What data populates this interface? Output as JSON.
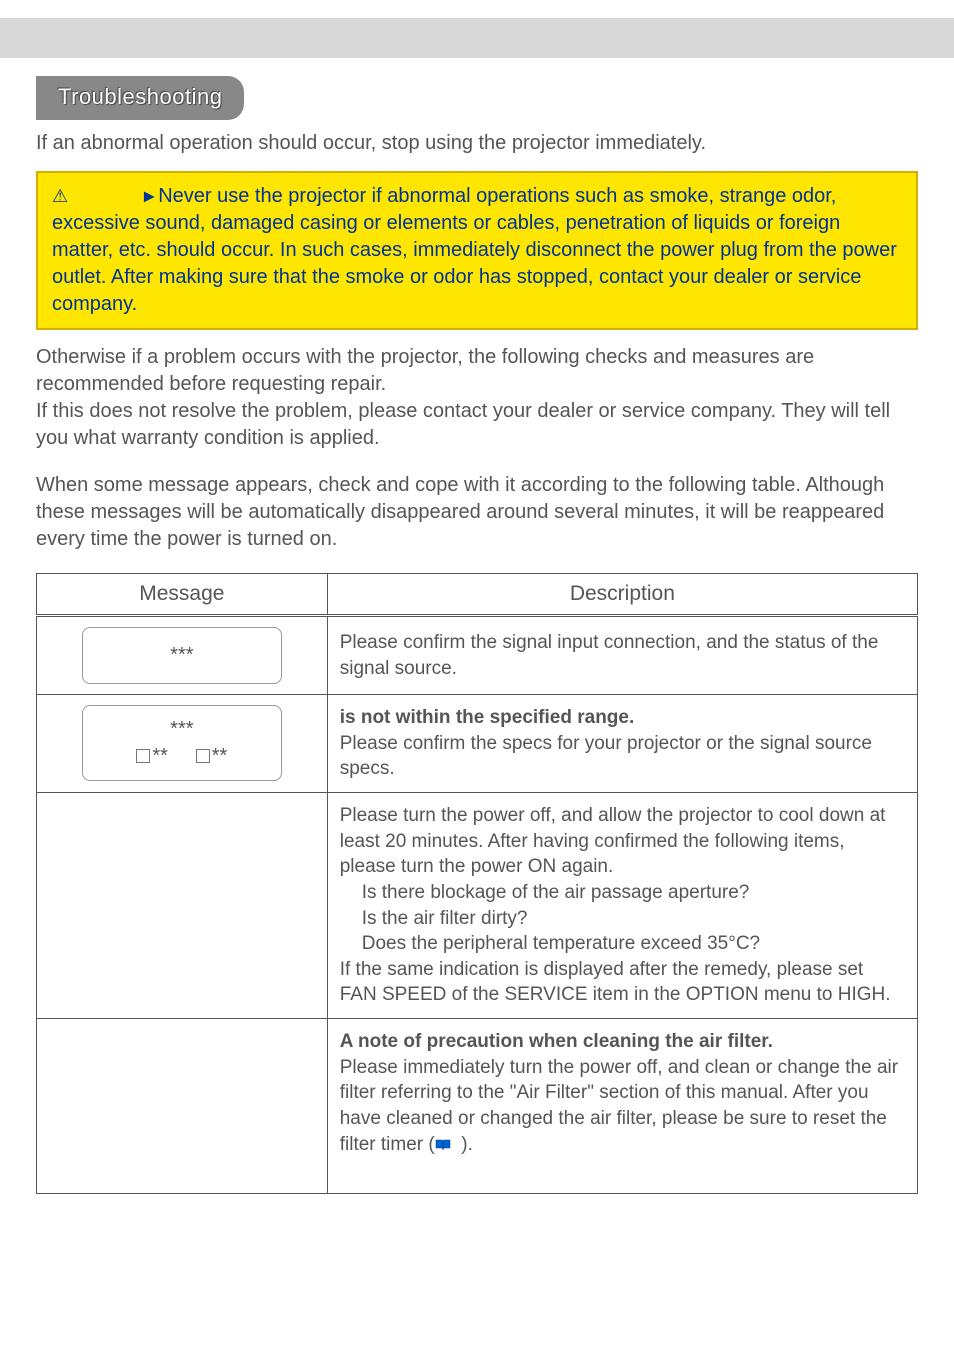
{
  "header": {
    "section_title": "Troubleshooting"
  },
  "intro": "If an abnormal operation should occur, stop using the projector immediately.",
  "warning": {
    "arrow": "►",
    "text": "Never use the projector if abnormal operations such as smoke, strange odor, excessive sound, damaged casing or elements or cables, penetration of liquids or foreign matter, etc. should occur. In such cases, immediately disconnect the power plug from the power outlet. After making sure that the smoke or odor has stopped, contact your dealer or service company."
  },
  "para1": "Otherwise if a problem occurs with the projector, the following checks and measures are recommended before requesting repair.",
  "para2": "If this does not resolve the problem, please contact your dealer or service company. They will tell you what warranty condition is applied.",
  "para3": "When some message appears, check and cope with it according to the following table. Although these messages will be automatically disappeared around several minutes, it will be reappeared every time the power is turned on.",
  "table": {
    "col_message": "Message",
    "col_description": "Description",
    "rows": [
      {
        "msg": "***",
        "desc": "Please confirm the signal input connection, and the status of the signal source."
      },
      {
        "msg_line1": "***",
        "msg_cb1": "**",
        "msg_cb2": "**",
        "desc_bold": "is not within the specified range.",
        "desc_rest": "Please confirm the specs for your projector or the signal source specs."
      },
      {
        "d1": "Please turn the power off, and allow the projector to cool down at least 20 minutes. After having confirmed the following items, please turn the power ON again.",
        "b1": "Is there blockage of the air passage aperture?",
        "b2": "Is the air filter dirty?",
        "b3": "Does the peripheral temperature exceed 35°C?",
        "d2": "If the same indication is displayed after the remedy, please set FAN SPEED of the SERVICE item in the OPTION menu to HIGH."
      },
      {
        "title": "A note of precaution when cleaning the air filter.",
        "body1": "Please immediately turn the power off, and clean or change the air filter referring to the \"Air Filter\" section of this manual. After you have cleaned or changed the air filter, please be sure to reset the filter timer (",
        "body2": ")."
      }
    ]
  }
}
